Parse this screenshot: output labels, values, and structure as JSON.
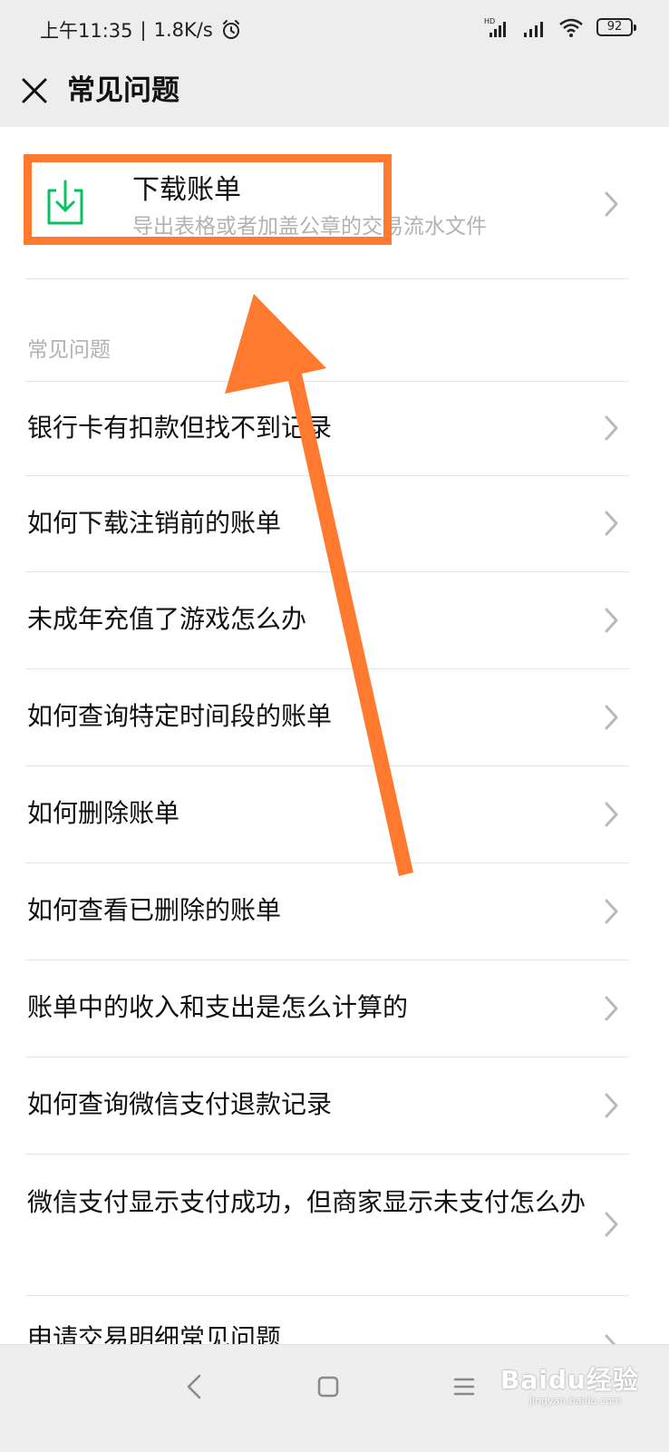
{
  "status_bar": {
    "time": "上午11:35",
    "separator": "|",
    "speed": "1.8K/s",
    "battery": "92",
    "hd_label": "HD"
  },
  "nav": {
    "title": "常见问题",
    "close_icon": "close-icon"
  },
  "download": {
    "title": "下载账单",
    "subtitle": "导出表格或者加盖公章的交易流水文件",
    "icon": "download-icon"
  },
  "section": {
    "header": "常见问题"
  },
  "faq": {
    "items": [
      "银行卡有扣款但找不到记录",
      "如何下载注销前的账单",
      "未成年充值了游戏怎么办",
      "如何查询特定时间段的账单",
      "如何删除账单",
      "如何查看已删除的账单",
      "账单中的收入和支出是怎么计算的",
      "如何查询微信支付退款记录",
      "微信支付显示支付成功，但商家显示未支付怎么办",
      "申请交易明细常见问题"
    ]
  },
  "watermark": {
    "brand": "Baidu经验",
    "url": "jingyan.baidu.com"
  },
  "colors": {
    "accent_green": "#07c160",
    "highlight_orange": "#ff7a2f",
    "nav_bg": "#ededed"
  }
}
